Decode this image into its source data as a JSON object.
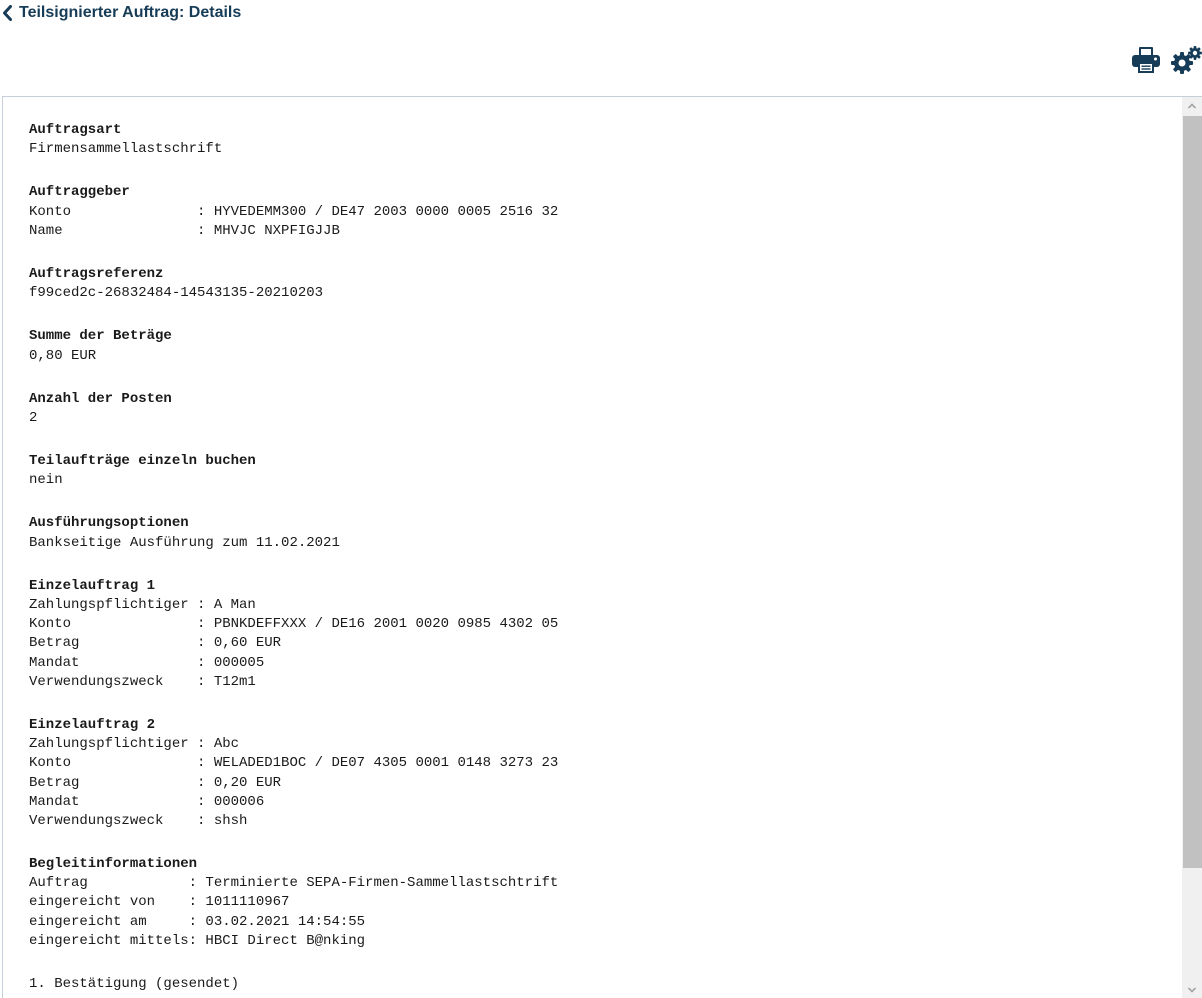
{
  "header": {
    "title": "Teilsignierter Auftrag: Details",
    "back_icon": "chevron-left-icon",
    "print_icon": "printer-icon",
    "settings_icon": "gears-icon"
  },
  "colors": {
    "title": "#173c57",
    "icon": "#173c57",
    "text": "#1a1a1a",
    "frame_border": "#c6d0da",
    "scroll_thumb": "#c1c1c1"
  },
  "details": {
    "auftragsart": {
      "title": "Auftragsart",
      "lines": [
        "Firmensammellastschrift"
      ]
    },
    "auftraggeber": {
      "title": "Auftraggeber",
      "lines": [
        "Konto               : HYVEDEMM300 / DE47 2003 0000 0005 2516 32",
        "Name                : MHVJC NXPFIGJJB"
      ]
    },
    "auftragsreferenz": {
      "title": "Auftragsreferenz",
      "lines": [
        "f99ced2c-26832484-14543135-20210203"
      ]
    },
    "summe": {
      "title": "Summe der Beträge",
      "lines": [
        "0,80 EUR"
      ]
    },
    "anzahl": {
      "title": "Anzahl der Posten",
      "lines": [
        "2"
      ]
    },
    "teilauftraege": {
      "title": "Teilaufträge einzeln buchen",
      "lines": [
        "nein"
      ]
    },
    "ausfuehrungsoptionen": {
      "title": "Ausführungsoptionen",
      "lines": [
        "Bankseitige Ausführung zum 11.02.2021"
      ]
    },
    "einzelauftrag_1": {
      "title": "Einzelauftrag 1",
      "lines": [
        "Zahlungspflichtiger : A Man",
        "Konto               : PBNKDEFFXXX / DE16 2001 0020 0985 4302 05",
        "Betrag              : 0,60 EUR",
        "Mandat              : 000005",
        "Verwendungszweck    : T12m1"
      ]
    },
    "einzelauftrag_2": {
      "title": "Einzelauftrag 2",
      "lines": [
        "Zahlungspflichtiger : Abc",
        "Konto               : WELADED1BOC / DE07 4305 0001 0148 3273 23",
        "Betrag              : 0,20 EUR",
        "Mandat              : 000006",
        "Verwendungszweck    : shsh"
      ]
    },
    "begleitinformationen": {
      "title": "Begleitinformationen",
      "lines": [
        "Auftrag            : Terminierte SEPA-Firmen-Sammellastschtrift",
        "eingereicht von    : 1011110967",
        "eingereicht am     : 03.02.2021 14:54:55",
        "eingereicht mittels: HBCI Direct B@nking"
      ]
    },
    "bestaetigung": {
      "lines": [
        "1. Bestätigung (gesendet)"
      ]
    }
  }
}
